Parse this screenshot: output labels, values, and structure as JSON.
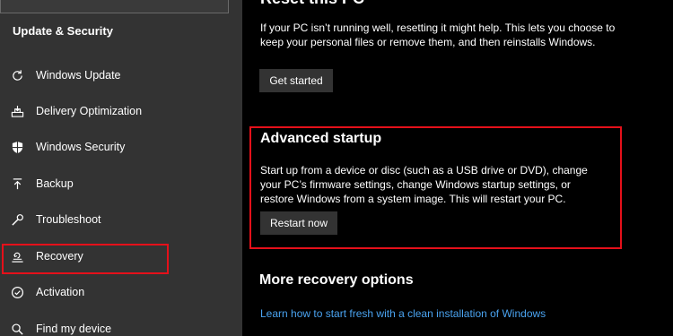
{
  "sidebar": {
    "section_title": "Update & Security",
    "items": [
      {
        "label": "Windows Update",
        "icon": "refresh-icon"
      },
      {
        "label": "Delivery Optimization",
        "icon": "delivery-optimization-icon"
      },
      {
        "label": "Windows Security",
        "icon": "shield-icon"
      },
      {
        "label": "Backup",
        "icon": "backup-arrow-icon"
      },
      {
        "label": "Troubleshoot",
        "icon": "wrench-icon"
      },
      {
        "label": "Recovery",
        "icon": "recovery-icon"
      },
      {
        "label": "Activation",
        "icon": "activation-check-icon"
      },
      {
        "label": "Find my device",
        "icon": "find-device-icon"
      }
    ]
  },
  "main": {
    "clipped_heading": "Reset this PC",
    "reset_description": "If your PC isn’t running well, resetting it might help. This lets you choose to keep your personal files or remove them, and then reinstalls Windows.",
    "get_started_label": "Get started",
    "advanced": {
      "heading": "Advanced startup",
      "description": "Start up from a device or disc (such as a USB drive or DVD), change your PC’s firmware settings, change Windows startup settings, or restore Windows from a system image. This will restart your PC.",
      "restart_label": "Restart now"
    },
    "more_heading": "More recovery options",
    "learn_link": "Learn how to start fresh with a clean installation of Windows"
  },
  "colors": {
    "sidebar_bg": "#333333",
    "main_bg": "#000000",
    "button_bg": "#333333",
    "highlight": "#e5101a",
    "link": "#4aa3f0"
  }
}
